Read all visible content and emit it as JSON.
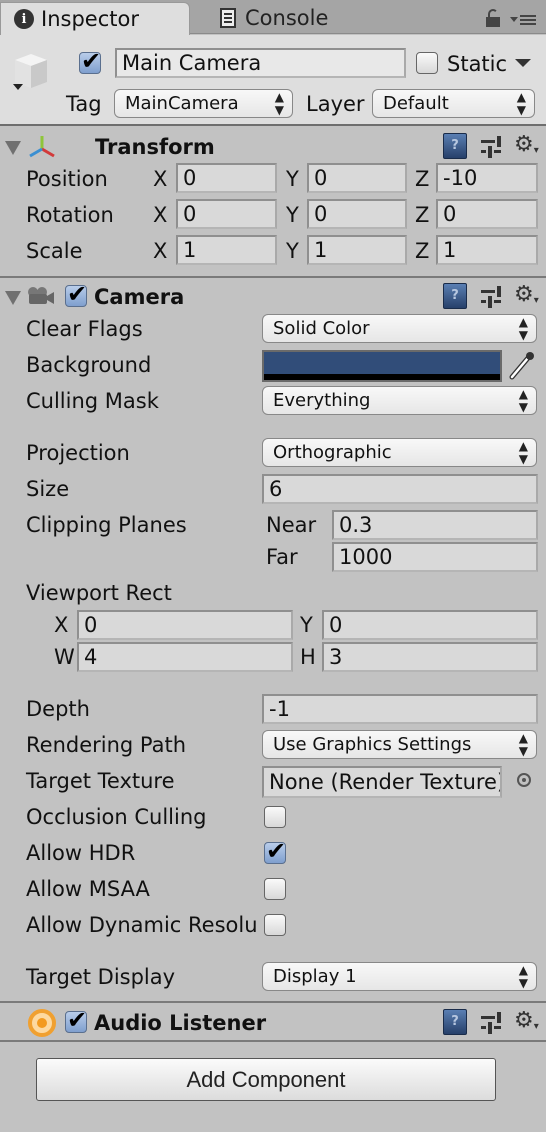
{
  "tabs": [
    {
      "label": "Inspector",
      "icon": "info-icon",
      "active": true
    },
    {
      "label": "Console",
      "icon": "console-icon",
      "active": false
    }
  ],
  "header": {
    "active": true,
    "name": "Main Camera",
    "static_label": "Static",
    "static": false,
    "tag_label": "Tag",
    "tag_value": "MainCamera",
    "layer_label": "Layer",
    "layer_value": "Default"
  },
  "transform": {
    "title": "Transform",
    "rows": [
      {
        "label": "Position",
        "x": "0",
        "y": "0",
        "z": "-10"
      },
      {
        "label": "Rotation",
        "x": "0",
        "y": "0",
        "z": "0"
      },
      {
        "label": "Scale",
        "x": "1",
        "y": "1",
        "z": "1"
      }
    ],
    "axes": {
      "x": "X",
      "y": "Y",
      "z": "Z"
    }
  },
  "camera": {
    "title": "Camera",
    "enabled": true,
    "clear_flags_label": "Clear Flags",
    "clear_flags": "Solid Color",
    "background_label": "Background",
    "background_color": "#314D79",
    "culling_mask_label": "Culling Mask",
    "culling_mask": "Everything",
    "projection_label": "Projection",
    "projection": "Orthographic",
    "size_label": "Size",
    "size": "6",
    "clipping_label": "Clipping Planes",
    "near_label": "Near",
    "near": "0.3",
    "far_label": "Far",
    "far": "1000",
    "viewport_label": "Viewport Rect",
    "viewport": {
      "x_label": "X",
      "x": "0",
      "y_label": "Y",
      "y": "0",
      "w_label": "W",
      "w": "4",
      "h_label": "H",
      "h": "3"
    },
    "depth_label": "Depth",
    "depth": "-1",
    "rendering_path_label": "Rendering Path",
    "rendering_path": "Use Graphics Settings",
    "target_texture_label": "Target Texture",
    "target_texture": "None (Render Texture)",
    "occlusion_label": "Occlusion Culling",
    "occlusion": false,
    "hdr_label": "Allow HDR",
    "hdr": true,
    "msaa_label": "Allow MSAA",
    "msaa": false,
    "dynres_label": "Allow Dynamic Resolu",
    "dynres": false,
    "target_display_label": "Target Display",
    "target_display": "Display 1"
  },
  "audio_listener": {
    "title": "Audio Listener",
    "enabled": true
  },
  "add_component_label": "Add Component"
}
